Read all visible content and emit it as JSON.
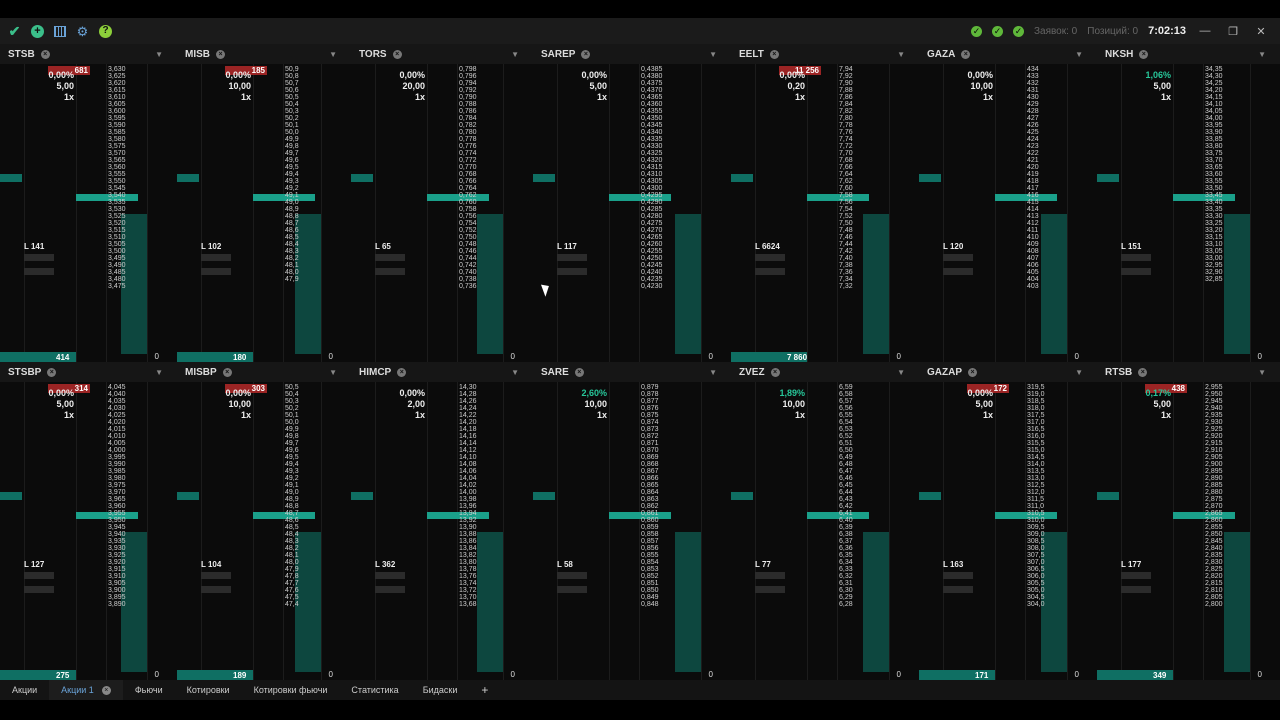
{
  "titlebar": {
    "orders_label": "Заявок: 0",
    "positions_label": "Позиций: 0",
    "time": "7:02:13"
  },
  "panels": [
    {
      "ticker": "STSB",
      "badge": "681",
      "pct": "0,00%",
      "lot": "5,00",
      "mult": "1x",
      "pct_pos": false,
      "count": "L 141",
      "bottom": "414",
      "prices": "3,630\n3,625\n3,620\n3,615\n3,610\n3,605\n3,600\n3,595\n3,590\n3,585\n3,580\n3,575\n3,570\n3,565\n3,560\n3,555\n3,550\n3,545\n3,540\n3,535\n3,530\n3,525\n3,520\n3,515\n3,510\n3,505\n3,500\n3,495\n3,490\n3,485\n3,480\n3,475"
    },
    {
      "ticker": "MISB",
      "badge": "185",
      "pct": "0,00%",
      "lot": "10,00",
      "mult": "1x",
      "pct_pos": false,
      "count": "L 102",
      "bottom": "180",
      "prices": "50,9\n50,8\n50,7\n50,6\n50,5\n50,4\n50,3\n50,2\n50,1\n50,0\n49,9\n49,8\n49,7\n49,6\n49,5\n49,4\n49,3\n49,2\n49,1\n49,0\n48,9\n48,8\n48,7\n48,6\n48,5\n48,4\n48,3\n48,2\n48,1\n48,0\n47,9"
    },
    {
      "ticker": "TORS",
      "badge": "",
      "pct": "0,00%",
      "lot": "20,00",
      "mult": "1x",
      "pct_pos": false,
      "count": "L 65",
      "bottom": "",
      "prices": "0,798\n0,796\n0,794\n0,792\n0,790\n0,788\n0,786\n0,784\n0,782\n0,780\n0,778\n0,776\n0,774\n0,772\n0,770\n0,768\n0,766\n0,764\n0,762\n0,760\n0,758\n0,756\n0,754\n0,752\n0,750\n0,748\n0,746\n0,744\n0,742\n0,740\n0,738\n0,736"
    },
    {
      "ticker": "SAREP",
      "badge": "",
      "pct": "0,00%",
      "lot": "5,00",
      "mult": "1x",
      "pct_pos": false,
      "count": "L 117",
      "bottom": "",
      "prices": "0,4385\n0,4380\n0,4375\n0,4370\n0,4365\n0,4360\n0,4355\n0,4350\n0,4345\n0,4340\n0,4335\n0,4330\n0,4325\n0,4320\n0,4315\n0,4310\n0,4305\n0,4300\n0,4295\n0,4290\n0,4285\n0,4280\n0,4275\n0,4270\n0,4265\n0,4260\n0,4255\n0,4250\n0,4245\n0,4240\n0,4235\n0,4230"
    },
    {
      "ticker": "EELT",
      "badge": "11 256",
      "pct": "0,00%",
      "lot": "0,20",
      "mult": "1x",
      "pct_pos": false,
      "count": "L 6624",
      "bottom": "7 860",
      "prices": "7,94\n7,92\n7,90\n7,88\n7,86\n7,84\n7,82\n7,80\n7,78\n7,76\n7,74\n7,72\n7,70\n7,68\n7,66\n7,64\n7,62\n7,60\n7,58\n7,56\n7,54\n7,52\n7,50\n7,48\n7,46\n7,44\n7,42\n7,40\n7,38\n7,36\n7,34\n7,32"
    },
    {
      "ticker": "GAZA",
      "badge": "",
      "pct": "0,00%",
      "lot": "10,00",
      "mult": "1x",
      "pct_pos": false,
      "count": "L 120",
      "bottom": "",
      "prices": "434\n433\n432\n431\n430\n429\n428\n427\n426\n425\n424\n423\n422\n421\n420\n419\n418\n417\n416\n415\n414\n413\n412\n411\n410\n409\n408\n407\n406\n405\n404\n403"
    },
    {
      "ticker": "NKSH",
      "badge": "",
      "pct": "1,06%",
      "lot": "5,00",
      "mult": "1x",
      "pct_pos": true,
      "count": "L 151",
      "bottom": "",
      "prices": "34,35\n34,30\n34,25\n34,20\n34,15\n34,10\n34,05\n34,00\n33,95\n33,90\n33,85\n33,80\n33,75\n33,70\n33,65\n33,60\n33,55\n33,50\n33,45\n33,40\n33,35\n33,30\n33,25\n33,20\n33,15\n33,10\n33,05\n33,00\n32,95\n32,90\n32,85"
    },
    {
      "ticker": "STSBP",
      "badge": "314",
      "pct": "0,00%",
      "lot": "5,00",
      "mult": "1x",
      "pct_pos": false,
      "count": "L 127",
      "bottom": "275",
      "prices": "4,045\n4,040\n4,035\n4,030\n4,025\n4,020\n4,015\n4,010\n4,005\n4,000\n3,995\n3,990\n3,985\n3,980\n3,975\n3,970\n3,965\n3,960\n3,955\n3,950\n3,945\n3,940\n3,935\n3,930\n3,925\n3,920\n3,915\n3,910\n3,905\n3,900\n3,895\n3,890"
    },
    {
      "ticker": "MISBP",
      "badge": "303",
      "pct": "0,00%",
      "lot": "10,00",
      "mult": "1x",
      "pct_pos": false,
      "count": "L 104",
      "bottom": "189",
      "prices": "50,5\n50,4\n50,3\n50,2\n50,1\n50,0\n49,9\n49,8\n49,7\n49,6\n49,5\n49,4\n49,3\n49,2\n49,1\n49,0\n48,9\n48,8\n48,7\n48,6\n48,5\n48,4\n48,3\n48,2\n48,1\n48,0\n47,9\n47,8\n47,7\n47,6\n47,5\n47,4"
    },
    {
      "ticker": "HIMCP",
      "badge": "",
      "pct": "0,00%",
      "lot": "2,00",
      "mult": "1x",
      "pct_pos": false,
      "count": "L 362",
      "bottom": "",
      "prices": "14,30\n14,28\n14,26\n14,24\n14,22\n14,20\n14,18\n14,16\n14,14\n14,12\n14,10\n14,08\n14,06\n14,04\n14,02\n14,00\n13,98\n13,96\n13,94\n13,92\n13,90\n13,88\n13,86\n13,84\n13,82\n13,80\n13,78\n13,76\n13,74\n13,72\n13,70\n13,68"
    },
    {
      "ticker": "SARE",
      "badge": "",
      "pct": "2,60%",
      "lot": "10,00",
      "mult": "1x",
      "pct_pos": true,
      "count": "L 58",
      "bottom": "",
      "prices": "0,879\n0,878\n0,877\n0,876\n0,875\n0,874\n0,873\n0,872\n0,871\n0,870\n0,869\n0,868\n0,867\n0,866\n0,865\n0,864\n0,863\n0,862\n0,861\n0,860\n0,859\n0,858\n0,857\n0,856\n0,855\n0,854\n0,853\n0,852\n0,851\n0,850\n0,849\n0,848"
    },
    {
      "ticker": "ZVEZ",
      "badge": "",
      "pct": "1,89%",
      "lot": "10,00",
      "mult": "1x",
      "pct_pos": true,
      "count": "L 77",
      "bottom": "",
      "prices": "6,59\n6,58\n6,57\n6,56\n6,55\n6,54\n6,53\n6,52\n6,51\n6,50\n6,49\n6,48\n6,47\n6,46\n6,45\n6,44\n6,43\n6,42\n6,41\n6,40\n6,39\n6,38\n6,37\n6,36\n6,35\n6,34\n6,33\n6,32\n6,31\n6,30\n6,29\n6,28"
    },
    {
      "ticker": "GAZAP",
      "badge": "172",
      "pct": "0,00%",
      "lot": "5,00",
      "mult": "1x",
      "pct_pos": false,
      "count": "L 163",
      "bottom": "171",
      "prices": "319,5\n319,0\n318,5\n318,0\n317,5\n317,0\n316,5\n316,0\n315,5\n315,0\n314,5\n314,0\n313,5\n313,0\n312,5\n312,0\n311,5\n311,0\n310,5\n310,0\n309,5\n309,0\n308,5\n308,0\n307,5\n307,0\n306,5\n306,0\n305,5\n305,0\n304,5\n304,0"
    },
    {
      "ticker": "RTSB",
      "badge": "438",
      "pct": "0,17%",
      "lot": "5,00",
      "mult": "1x",
      "pct_pos": true,
      "count": "L 177",
      "bottom": "349",
      "prices": "2,955\n2,950\n2,945\n2,940\n2,935\n2,930\n2,925\n2,920\n2,915\n2,910\n2,905\n2,900\n2,895\n2,890\n2,885\n2,880\n2,875\n2,870\n2,865\n2,860\n2,855\n2,850\n2,845\n2,840\n2,835\n2,830\n2,825\n2,820\n2,815\n2,810\n2,805\n2,800"
    }
  ],
  "tabs": [
    "Акции",
    "Акции 1",
    "Фьючи",
    "Котировки",
    "Котировки фьючи",
    "Статистика",
    "Бидаски"
  ],
  "zero": "0"
}
